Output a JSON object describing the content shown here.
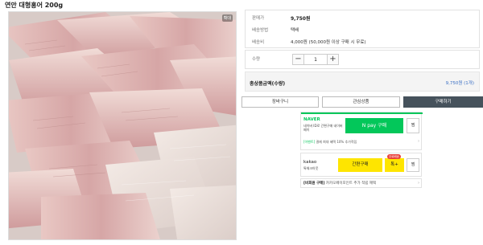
{
  "product": {
    "title": "연안 대형홍어 200g",
    "zoom_badge": "확대"
  },
  "info": {
    "price_label": "판매가",
    "price_value": "9,750원",
    "shipping_method_label": "배송방법",
    "shipping_method_value": "택배",
    "shipping_fee_label": "배송비",
    "shipping_fee_value": "4,000원 (50,000원 이상 구매 시 무료)"
  },
  "quantity": {
    "label": "수량",
    "minus": "−",
    "value": "1",
    "plus": "+"
  },
  "total": {
    "label": "총상품금액(수량)",
    "value": "9,750원 (1개)"
  },
  "buttons": {
    "cart": "장바구니",
    "wishlist": "관심상품",
    "buy": "구매하기"
  },
  "naver": {
    "logo": "NAVER",
    "sub": "네이버 ID로 간편구매 네이버페이",
    "pay_label": "N pay 구매",
    "wish_label": "찜",
    "benefit_tag": "[이벤트]",
    "benefit_text": "결제 최대 혜택 10% 추가적립"
  },
  "kakao": {
    "logo": "kakao",
    "sub": "톡체크아웃",
    "buy_label": "간편구매",
    "talk_label": "톡+",
    "badge": "무료배송",
    "wish_label": "찜"
  },
  "member": {
    "tag": "[비회원 구매]",
    "text": "카카오페이포인트 추가 적립 혜택"
  },
  "colors": {
    "naver_green": "#03c75a",
    "kakao_yellow": "#fee500",
    "buy_button": "#46525c",
    "total_value": "#3a6fc4"
  }
}
